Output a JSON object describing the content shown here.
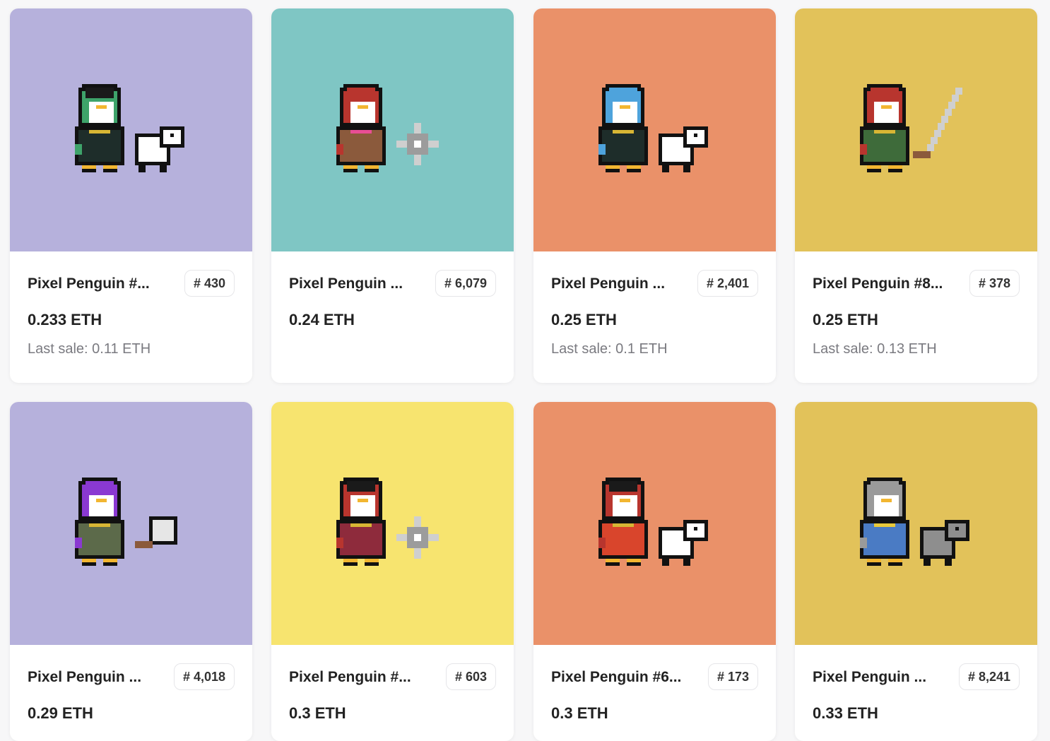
{
  "cards": [
    {
      "name": "Pixel Penguin #...",
      "token": "# 430",
      "price": "0.233 ETH",
      "last_sale": "Last sale: 0.11 ETH",
      "bg": "#b6b1dc",
      "hat": "#1a1a1a",
      "face": "#3ea36a",
      "body": "#1e2d2a",
      "accent": "#d8b634",
      "pet": "cat",
      "item": "none"
    },
    {
      "name": "Pixel Penguin ...",
      "token": "# 6,079",
      "price": "0.24 ETH",
      "last_sale": "",
      "bg": "#7fc6c4",
      "hat": "#b8352e",
      "face": "#b8352e",
      "body": "#8b5a3c",
      "accent": "#e84e94",
      "pet": "none",
      "item": "shuriken"
    },
    {
      "name": "Pixel Penguin ...",
      "token": "# 2,401",
      "price": "0.25 ETH",
      "last_sale": "Last sale: 0.1 ETH",
      "bg": "#ea9169",
      "hat": "#4ea3dc",
      "face": "#4ea3dc",
      "body": "#1e2d2a",
      "accent": "#d8b634",
      "pet": "cat",
      "item": "none"
    },
    {
      "name": "Pixel Penguin #8...",
      "token": "# 378",
      "price": "0.25 ETH",
      "last_sale": "Last sale: 0.13 ETH",
      "bg": "#e2c25a",
      "hat": "#b8352e",
      "face": "#b8352e",
      "body": "#3e6b3a",
      "accent": "#d8b634",
      "pet": "none",
      "item": "sword"
    },
    {
      "name": "Pixel Penguin ...",
      "token": "# 4,018",
      "price": "0.29 ETH",
      "last_sale": "",
      "bg": "#b6b1dc",
      "hat": "#8a39d1",
      "face": "#8a39d1",
      "body": "#5c6a4a",
      "accent": "#d8b634",
      "pet": "none",
      "item": "cleaver"
    },
    {
      "name": "Pixel Penguin #...",
      "token": "# 603",
      "price": "0.3 ETH",
      "last_sale": "",
      "bg": "#f7e46f",
      "hat": "#1a1a1a",
      "face": "#b8352e",
      "body": "#8e2b3c",
      "accent": "#d8b634",
      "pet": "none",
      "item": "shuriken"
    },
    {
      "name": "Pixel Penguin #6...",
      "token": "# 173",
      "price": "0.3 ETH",
      "last_sale": "",
      "bg": "#ea9169",
      "hat": "#1a1a1a",
      "face": "#b8352e",
      "body": "#d9452c",
      "accent": "#d8b634",
      "pet": "cat",
      "item": "none"
    },
    {
      "name": "Pixel Penguin ...",
      "token": "# 8,241",
      "price": "0.33 ETH",
      "last_sale": "",
      "bg": "#e2c25a",
      "hat": "#9a9a9a",
      "face": "#9a9a9a",
      "body": "#4a7bc4",
      "accent": "#e8c93a",
      "pet": "dog",
      "item": "none"
    }
  ]
}
